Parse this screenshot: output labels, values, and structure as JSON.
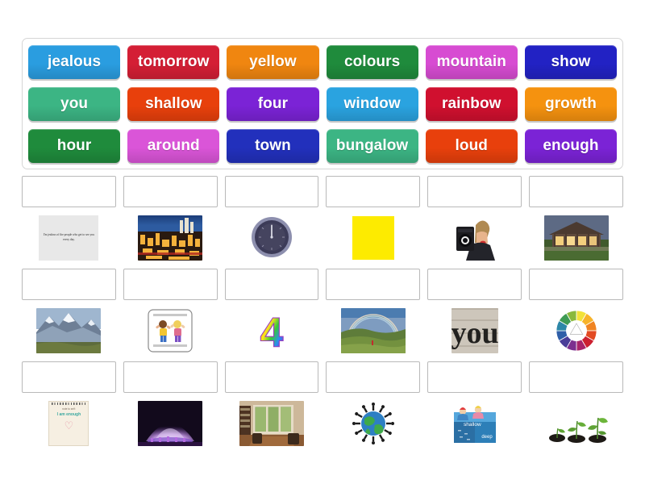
{
  "activity": {
    "type": "match-up-drag-and-drop",
    "word_bank": {
      "rows": [
        [
          {
            "label": "jealous",
            "color": "#2a9de0"
          },
          {
            "label": "tomorrow",
            "color": "#d41f35"
          },
          {
            "label": "yellow",
            "color": "#f08610"
          },
          {
            "label": "colours",
            "color": "#1f8b3c"
          },
          {
            "label": "mountain",
            "color": "#d74cd2"
          },
          {
            "label": "show",
            "color": "#2222c4"
          }
        ],
        [
          {
            "label": "you",
            "color": "#3cb584"
          },
          {
            "label": "shallow",
            "color": "#e8400c"
          },
          {
            "label": "four",
            "color": "#7b23d6"
          },
          {
            "label": "window",
            "color": "#2aa3e0"
          },
          {
            "label": "rainbow",
            "color": "#d0102f"
          },
          {
            "label": "growth",
            "color": "#f5920f"
          }
        ],
        [
          {
            "label": "hour",
            "color": "#1f8b3c"
          },
          {
            "label": "around",
            "color": "#da55d8"
          },
          {
            "label": "town",
            "color": "#2230bc"
          },
          {
            "label": "bungalow",
            "color": "#3cb584"
          },
          {
            "label": "loud",
            "color": "#e8400c"
          },
          {
            "label": "enough",
            "color": "#7b23d6"
          }
        ]
      ]
    },
    "answers": {
      "rows": [
        [
          {
            "picture": "jealous-quote-card",
            "alt": "Quote card",
            "quote": "I'm jealous of the people who get to see you every day."
          },
          {
            "picture": "city-at-night-photo",
            "alt": "City skyline at night"
          },
          {
            "picture": "clock-face-image",
            "alt": "Clock showing twelve o'clock"
          },
          {
            "picture": "yellow-colour-swatch",
            "alt": "Solid yellow square"
          },
          {
            "picture": "shouting-person-speaker-photo",
            "alt": "Person shouting holding a speaker"
          },
          {
            "picture": "bungalow-house-photo",
            "alt": "Single storey bungalow house"
          }
        ],
        [
          {
            "picture": "snowy-mountain-photo",
            "alt": "Snow capped mountain range"
          },
          {
            "picture": "children-jumping-card",
            "alt": "Card with two cartoon children jumping"
          },
          {
            "picture": "rainbow-number-four",
            "alt": "Rainbow coloured numeral 4"
          },
          {
            "picture": "rainbow-landscape-photo",
            "alt": "Rainbow over green hills"
          },
          {
            "picture": "you-word-photo",
            "alt": "The word you painted on wood"
          },
          {
            "picture": "colour-wheel-image",
            "alt": "Twelve segment colour wheel"
          }
        ],
        [
          {
            "picture": "i-am-enough-notepad",
            "alt": "Notepad reading I am enough",
            "note_small": "note to self:",
            "note_main": "I am enough",
            "note_heart": "♡"
          },
          {
            "picture": "fountain-light-show-photo",
            "alt": "Purple fountain light show at night"
          },
          {
            "picture": "living-room-window-photo",
            "alt": "Bay window in a living room"
          },
          {
            "picture": "globe-people-around-image",
            "alt": "Globe ringed by people holding hands"
          },
          {
            "picture": "shallow-deep-pool-diagram",
            "alt": "Pool diagram labelled shallow and deep"
          },
          {
            "picture": "seedlings-growth-image",
            "alt": "Three seedlings growing in soil"
          }
        ]
      ]
    }
  }
}
